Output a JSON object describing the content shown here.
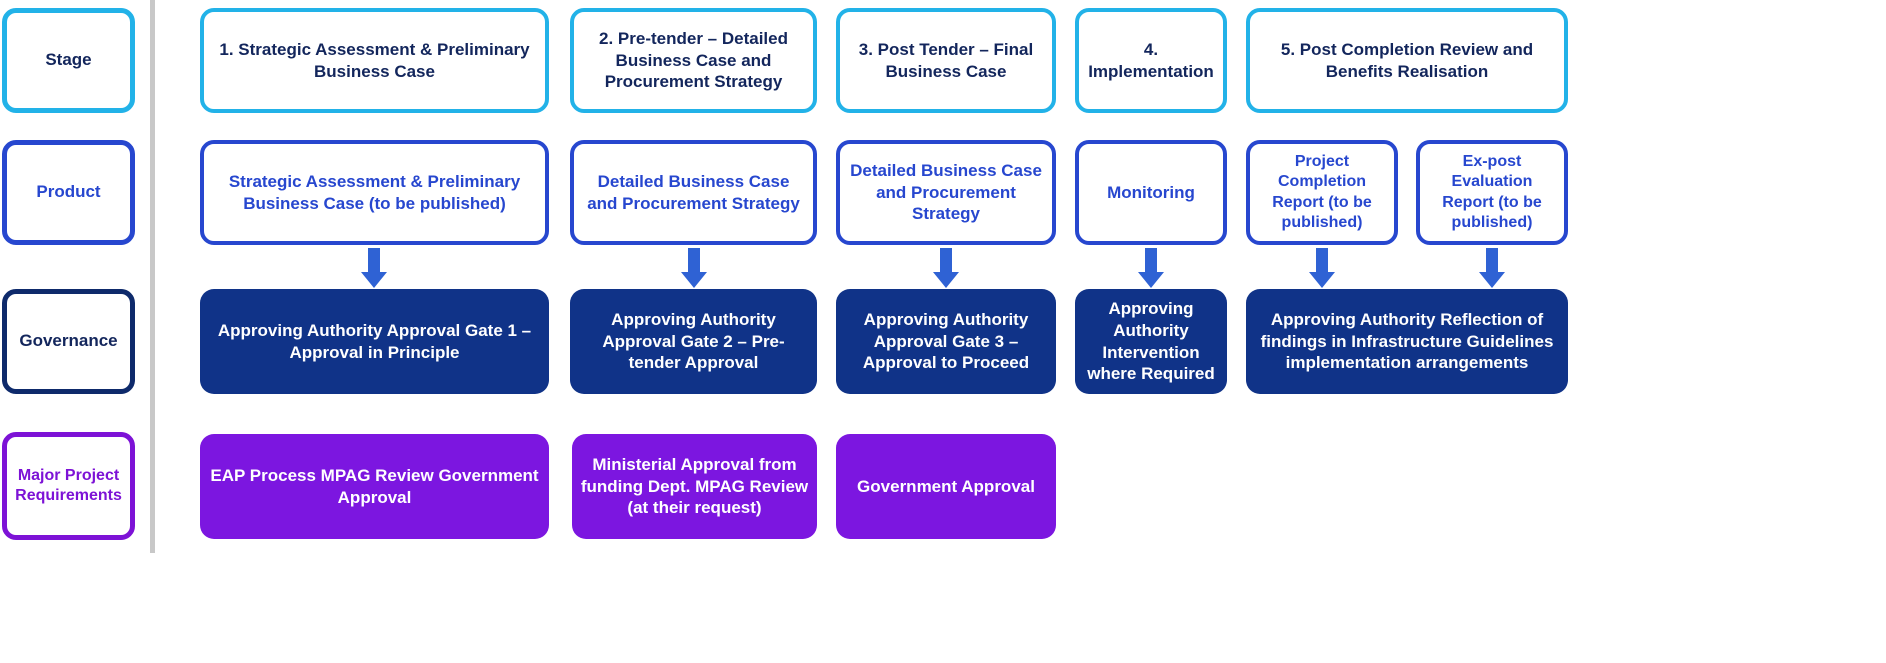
{
  "rows": {
    "stage": {
      "label": "Stage"
    },
    "product": {
      "label": "Product"
    },
    "governance": {
      "label": "Governance"
    },
    "major": {
      "label_line1": "Major Project",
      "label_line2": "Requirements"
    }
  },
  "colors": {
    "stage_border": "#22b2e8",
    "product_border": "#2747cf",
    "governance_fill": "#103388",
    "major_fill": "#7c16e0",
    "arrow": "#2f62d4",
    "navy_text": "#13265c",
    "purple_text": "#7d12d6"
  },
  "stage_boxes": [
    {
      "text": "1. Strategic Assessment & Preliminary Business Case"
    },
    {
      "text": "2. Pre-tender – Detailed Business Case and Procurement Strategy"
    },
    {
      "text": "3. Post Tender – Final Business Case"
    },
    {
      "text": "4. Implementation"
    },
    {
      "text": "5. Post Completion Review and Benefits Realisation"
    }
  ],
  "product_boxes": [
    {
      "text": "Strategic Assessment & Preliminary Business Case (to be published)"
    },
    {
      "text": "Detailed Business Case and Procurement Strategy"
    },
    {
      "text": "Detailed Business Case and Procurement Strategy"
    },
    {
      "text": "Monitoring"
    },
    {
      "text": "Project Completion Report (to be published)"
    },
    {
      "text": "Ex-post Evaluation Report (to be published)"
    }
  ],
  "governance_boxes": [
    {
      "text": "Approving Authority Approval Gate 1 – Approval in Principle"
    },
    {
      "text": "Approving Authority Approval Gate 2 – Pre-tender Approval"
    },
    {
      "text": "Approving Authority Approval Gate 3 – Approval to Proceed"
    },
    {
      "text": "Approving Authority Intervention where Required"
    },
    {
      "text": "Approving Authority Reflection of findings in Infrastructure Guidelines implementation arrangements"
    }
  ],
  "major_boxes": [
    {
      "text": "EAP Process MPAG Review Government Approval"
    },
    {
      "text": "Ministerial Approval from funding Dept. MPAG Review (at their request)"
    },
    {
      "text": "Government Approval"
    }
  ]
}
